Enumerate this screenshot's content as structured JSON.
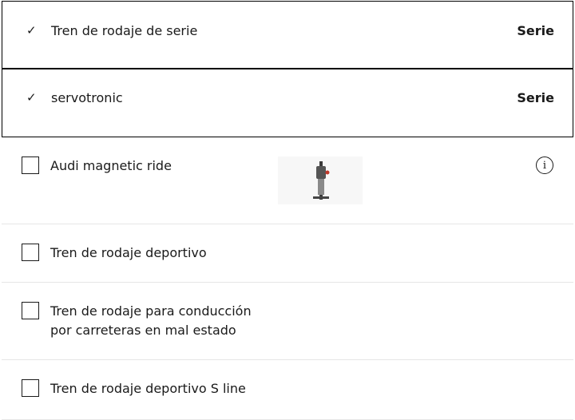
{
  "selected": [
    {
      "label": "Tren de rodaje de serie",
      "status": "Serie"
    },
    {
      "label": "servotronic",
      "status": "Serie"
    }
  ],
  "options": [
    {
      "label": "Audi magnetic ride",
      "has_image": true,
      "info_icon": "i"
    },
    {
      "label": "Tren de rodaje deportivo"
    },
    {
      "label_line1": "Tren de rodaje para conducción",
      "label_line2": "por carreteras en mal estado"
    },
    {
      "label": "Tren de rodaje deportivo S line"
    }
  ],
  "icons": {
    "check": "✓"
  }
}
